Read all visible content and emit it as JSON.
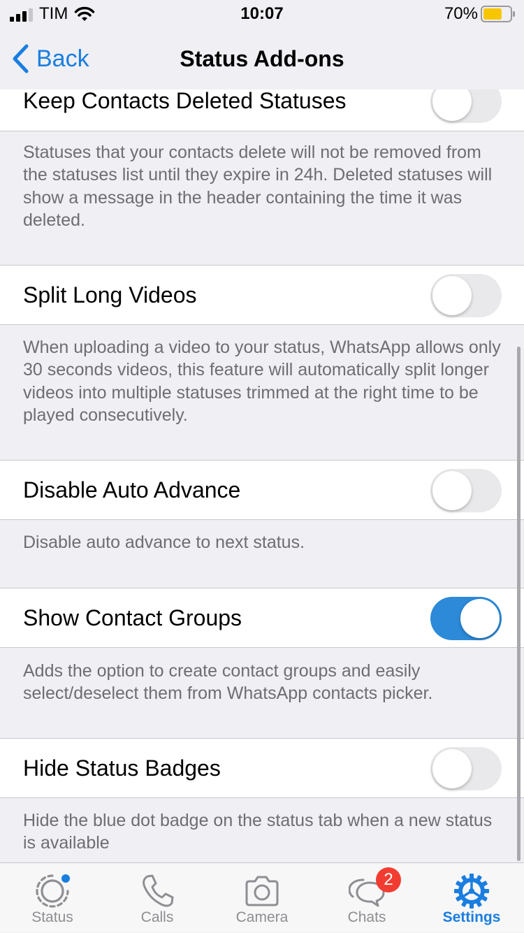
{
  "status_bar": {
    "carrier": "TIM",
    "time": "10:07",
    "battery": "70%",
    "battery_level": 0.7
  },
  "nav": {
    "back_label": "Back",
    "title": "Status Add-ons"
  },
  "settings": [
    {
      "label": "Keep Contacts Deleted Statuses",
      "on": false,
      "description": "Statuses that your contacts delete will not be removed from the statuses list until they expire in 24h. Deleted statuses will show a message in the header containing the time it was deleted."
    },
    {
      "label": "Split Long Videos",
      "on": false,
      "description": "When uploading a video to your status, WhatsApp allows only 30 seconds videos, this feature will automatically split longer videos into multiple statuses trimmed at the right time to be played consecutively."
    },
    {
      "label": "Disable Auto Advance",
      "on": false,
      "description": "Disable auto advance to next status."
    },
    {
      "label": "Show Contact Groups",
      "on": true,
      "description": "Adds the option to create contact groups and easily select/deselect them from WhatsApp contacts picker."
    },
    {
      "label": "Hide Status Badges",
      "on": false,
      "description": "Hide the blue dot badge on the status tab when a new status is available"
    }
  ],
  "tabs": [
    {
      "label": "Status",
      "icon": "status-icon"
    },
    {
      "label": "Calls",
      "icon": "phone-icon"
    },
    {
      "label": "Camera",
      "icon": "camera-icon"
    },
    {
      "label": "Chats",
      "icon": "chats-icon",
      "badge": "2"
    },
    {
      "label": "Settings",
      "icon": "gear-icon",
      "active": true
    }
  ],
  "colors": {
    "accent": "#1a7ee0",
    "toggle_on": "#2c8ad8",
    "badge": "#f23c31",
    "battery": "#f7c600"
  }
}
